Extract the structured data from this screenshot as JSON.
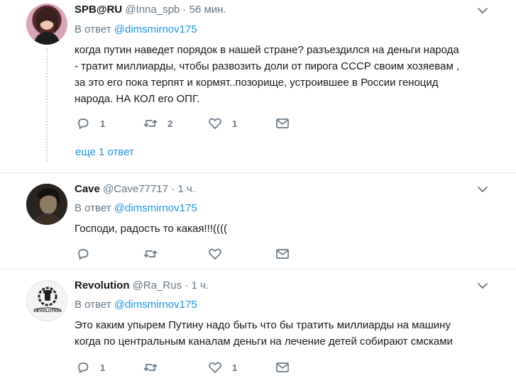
{
  "tweets": [
    {
      "name": "SPB@RU",
      "handle": "@Inna_spb",
      "separator": "·",
      "time": "56 мин.",
      "reply_prefix": "В ответ",
      "reply_handle": "@dimsmirnov175",
      "text": "когда путин наведет порядок в нашей стране? разъездился на деньги народа\n- тратит миллиарды, чтобы развозить доли от пирога СССР своим хозяевам ,\nза это его пока терпят и кормят..позорище, устроившее в России геноцид\nнарода. НА КОЛ его ОПГ.",
      "reply_count": "1",
      "retweet_count": "2",
      "like_count": "1",
      "more_replies": "еще 1 ответ",
      "icons": {
        "reply": "reply-icon",
        "retweet": "retweet-icon",
        "like": "heart-icon",
        "dm": "envelope-icon",
        "caret": "chevron-down-icon"
      }
    },
    {
      "name": "Cave",
      "handle": "@Cave77717",
      "separator": "·",
      "time": "1 ч.",
      "reply_prefix": "В ответ",
      "reply_handle": "@dimsmirnov175",
      "text": "Господи, радость то какая!!!((((",
      "reply_count": "",
      "retweet_count": "",
      "like_count": ""
    },
    {
      "name": "Revolution",
      "handle": "@Ra_Rus",
      "separator": "·",
      "time": "1 ч.",
      "reply_prefix": "В ответ",
      "reply_handle": "@dimsmirnov175",
      "text": "Это каким упырем Путину надо быть что бы тратить миллиарды на машину\nкогда по центральным каналам деньги на лечение детей собирают смсками",
      "reply_count": "1",
      "retweet_count": "",
      "like_count": "1",
      "avatar_logo_text": "REVOLUTION"
    }
  ],
  "colors": {
    "link": "#1b95e0",
    "secondary_text": "#657786",
    "primary_text": "#14171a",
    "divider": "#e6ecf0",
    "icon": "#657786"
  }
}
